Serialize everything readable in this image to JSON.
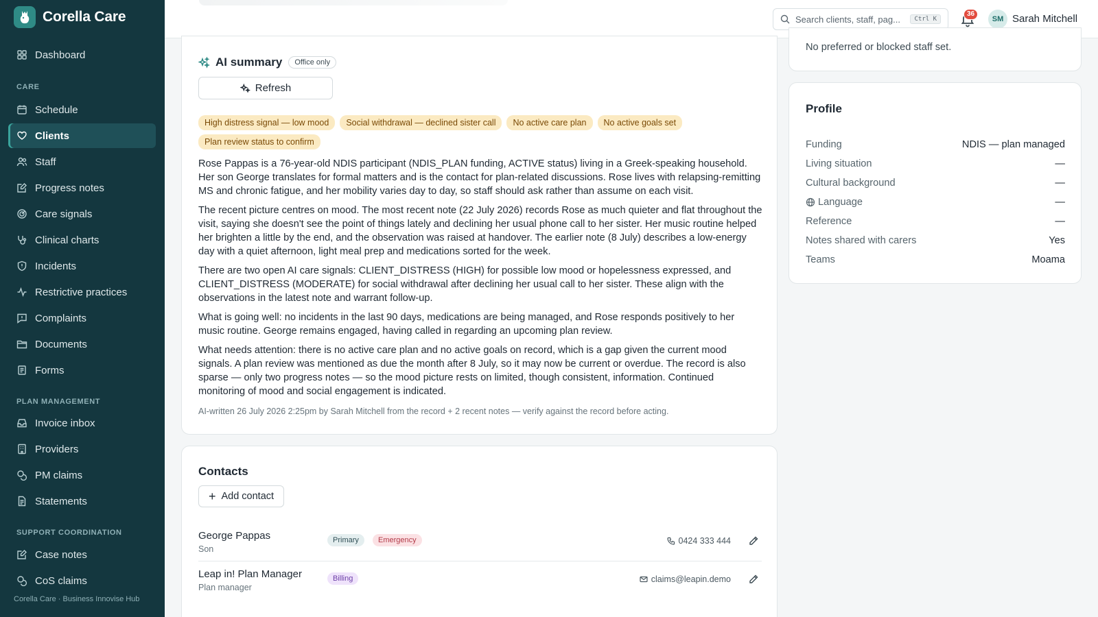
{
  "app": {
    "name": "Corella Care",
    "footer": "Corella Care · Business Innovise Hub"
  },
  "sidebar": {
    "items": [
      {
        "label": "Dashboard",
        "icon": "dashboard-icon"
      },
      {
        "label": "Schedule",
        "icon": "calendar-icon"
      },
      {
        "label": "Clients",
        "icon": "heart-hand-icon",
        "active": true
      },
      {
        "label": "Staff",
        "icon": "users-icon"
      },
      {
        "label": "Progress notes",
        "icon": "note-edit-icon"
      },
      {
        "label": "Care signals",
        "icon": "signal-icon"
      },
      {
        "label": "Clinical charts",
        "icon": "stethoscope-icon"
      },
      {
        "label": "Incidents",
        "icon": "shield-alert-icon"
      },
      {
        "label": "Restrictive practices",
        "icon": "activity-icon"
      },
      {
        "label": "Complaints",
        "icon": "message-alert-icon"
      },
      {
        "label": "Documents",
        "icon": "folder-icon"
      },
      {
        "label": "Forms",
        "icon": "form-icon"
      },
      {
        "label": "Invoice inbox",
        "icon": "inbox-icon"
      },
      {
        "label": "Providers",
        "icon": "building-icon"
      },
      {
        "label": "PM claims",
        "icon": "coins-icon"
      },
      {
        "label": "Statements",
        "icon": "document-icon"
      },
      {
        "label": "Case notes",
        "icon": "edit-note-icon"
      },
      {
        "label": "CoS claims",
        "icon": "coins-icon"
      }
    ],
    "sections": {
      "care": "CARE",
      "plan_management": "PLAN MANAGEMENT",
      "support_coordination": "SUPPORT COORDINATION"
    }
  },
  "topbar": {
    "search_placeholder": "Search clients, staff, pag...",
    "search_shortcut": "Ctrl K",
    "notification_count": "36",
    "user_initials": "SM",
    "user_name": "Sarah Mitchell"
  },
  "ai_summary": {
    "title": "AI summary",
    "badge": "Office only",
    "refresh_label": "Refresh",
    "tags": [
      "High distress signal — low mood",
      "Social withdrawal — declined sister call",
      "No active care plan",
      "No active goals set",
      "Plan review status to confirm"
    ],
    "paragraphs": [
      "Rose Pappas is a 76-year-old NDIS participant (NDIS_PLAN funding, ACTIVE status) living in a Greek-speaking household. Her son George translates for formal matters and is the contact for plan-related discussions. Rose lives with relapsing-remitting MS and chronic fatigue, and her mobility varies day to day, so staff should ask rather than assume on each visit.",
      "The recent picture centres on mood. The most recent note (22 July 2026) records Rose as much quieter and flat throughout the visit, saying she doesn't see the point of things lately and declining her usual phone call to her sister. Her music routine helped her brighten a little by the end, and the observation was raised at handover. The earlier note (8 July) describes a low-energy day with a quiet afternoon, light meal prep and medications sorted for the week.",
      "There are two open AI care signals: CLIENT_DISTRESS (HIGH) for possible low mood or hopelessness expressed, and CLIENT_DISTRESS (MODERATE) for social withdrawal after declining her usual call to her sister. These align with the observations in the latest note and warrant follow-up.",
      "What is going well: no incidents in the last 90 days, medications are being managed, and Rose responds positively to her music routine. George remains engaged, having called in regarding an upcoming plan review.",
      "What needs attention: there is no active care plan and no active goals on record, which is a gap given the current mood signals. A plan review was mentioned as due the month after 8 July, so it may now be current or overdue. The record is also sparse — only two progress notes — so the mood picture rests on limited, though consistent, information. Continued monitoring of mood and social engagement is indicated."
    ],
    "footnote": "AI-written 26 July 2026 2:25pm by Sarah Mitchell from the record + 2 recent notes — verify against the record before acting."
  },
  "contacts": {
    "title": "Contacts",
    "add_label": "Add contact",
    "rows": [
      {
        "name": "George Pappas",
        "relation": "Son",
        "badges": [
          "Primary",
          "Emergency"
        ],
        "info": "0424 333 444",
        "info_icon": "phone-icon"
      },
      {
        "name": "Leap in! Plan Manager",
        "relation": "Plan manager",
        "badges": [
          "Billing"
        ],
        "info": "claims@leapin.demo",
        "info_icon": "mail-icon"
      }
    ]
  },
  "preferences": {
    "text": "No preferred or blocked staff set."
  },
  "profile": {
    "title": "Profile",
    "rows": [
      {
        "label": "Funding",
        "value": "NDIS — plan managed"
      },
      {
        "label": "Living situation",
        "value": "—"
      },
      {
        "label": "Cultural background",
        "value": "—"
      },
      {
        "label": "Language",
        "value": "—",
        "icon": "globe-icon"
      },
      {
        "label": "Reference",
        "value": "—"
      },
      {
        "label": "Notes shared with carers",
        "value": "Yes"
      },
      {
        "label": "Teams",
        "value": "Moama"
      }
    ]
  },
  "colors": {
    "sidebar_bg": "#14373f",
    "active_item": "#1f5058",
    "accent": "#2f8b86",
    "tag_bg": "#fbeac2",
    "tag_text": "#7a4a06"
  }
}
